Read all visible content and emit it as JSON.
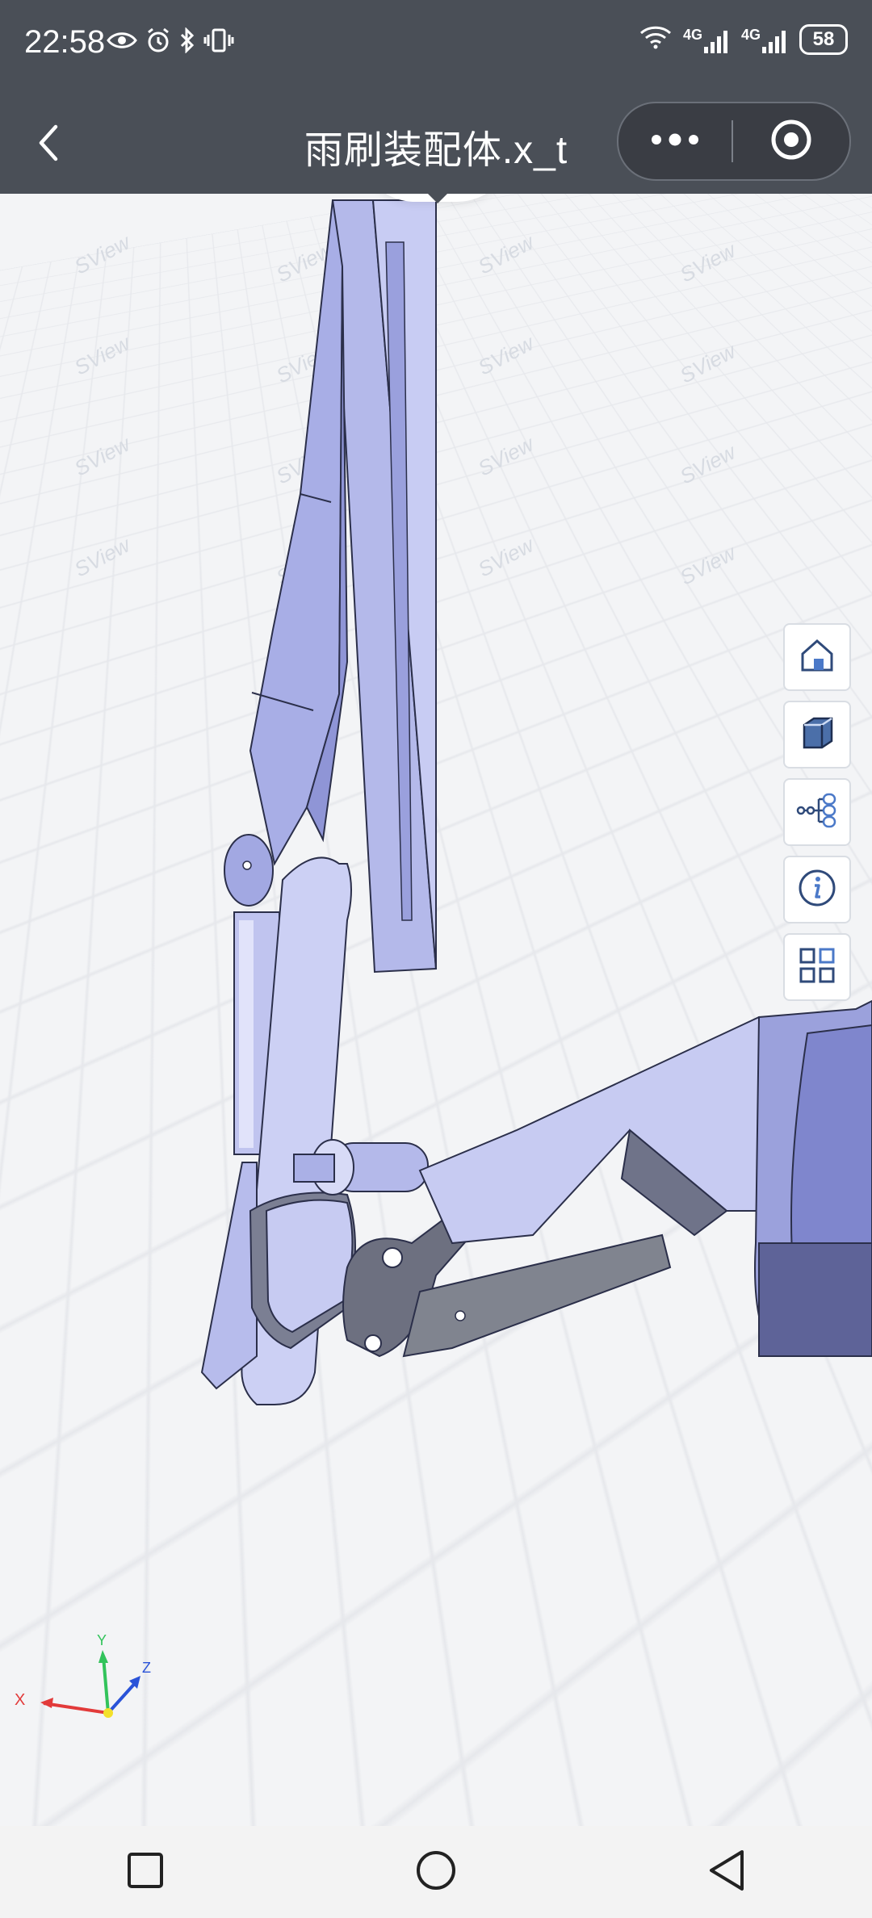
{
  "status_bar": {
    "time": "22:58",
    "left_icons": [
      "eye-icon",
      "alarm-icon",
      "bluetooth-icon",
      "vibrate-icon"
    ],
    "right_icons": [
      "wifi-icon",
      "signal-4g-1-icon",
      "signal-4g-2-icon"
    ],
    "network_label_1": "4G",
    "network_label_2": "4G",
    "battery": "58"
  },
  "nav": {
    "title": "雨刷装配体.x_t",
    "back_icon": "chevron-left-icon",
    "capsule_more_icon": "more-dots-icon",
    "capsule_target_icon": "target-icon"
  },
  "viewport": {
    "watermark": "SView",
    "model_color": "#b4b9ea",
    "tools": [
      {
        "name": "home-view-button",
        "icon": "home-icon"
      },
      {
        "name": "view-cube-button",
        "icon": "cube-icon"
      },
      {
        "name": "assembly-tree-button",
        "icon": "tree-icon"
      },
      {
        "name": "info-button",
        "icon": "info-icon"
      },
      {
        "name": "layout-button",
        "icon": "grid-icon"
      }
    ]
  },
  "axes": {
    "x_label": "X",
    "y_label": "Y",
    "z_label": "Z",
    "x_color": "#e23a3a",
    "y_color": "#32c35b",
    "z_color": "#2a53d8"
  },
  "bottom_nav": {
    "recent_icon": "square-icon",
    "home_icon": "circle-icon",
    "back_icon": "triangle-back-icon"
  }
}
